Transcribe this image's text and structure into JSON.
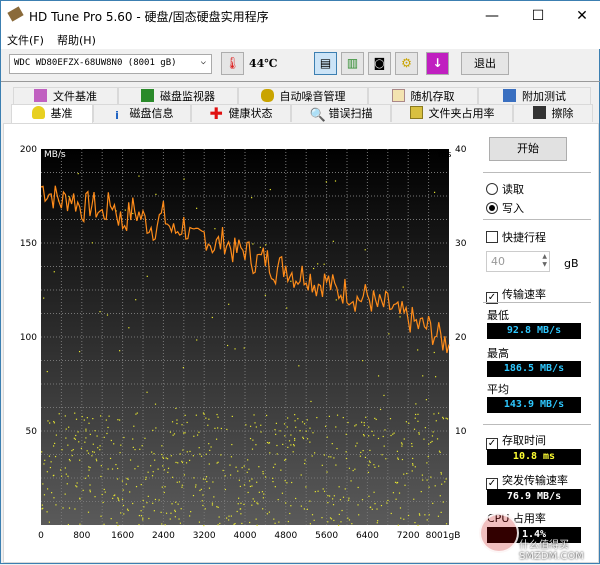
{
  "window": {
    "title": "HD Tune Pro 5.60 - 硬盘/固态硬盘实用程序",
    "minimize": "—",
    "maximize": "☐",
    "close": "✕"
  },
  "menu": [
    "文件(F)",
    "帮助(H)"
  ],
  "toolbar": {
    "drive": "WDC WD80EFZX-68UW8N0 (8001 gB)",
    "temperature": "44℃",
    "exit": "退出"
  },
  "tabs_top": [
    {
      "label": "文件基准",
      "icon": "file-benchmark-icon"
    },
    {
      "label": "磁盘监视器",
      "icon": "disk-monitor-icon"
    },
    {
      "label": "自动噪音管理",
      "icon": "speaker-icon"
    },
    {
      "label": "随机存取",
      "icon": "random-access-icon"
    },
    {
      "label": "附加测试",
      "icon": "extra-tests-icon"
    }
  ],
  "tabs_bottom": [
    {
      "label": "基准",
      "icon": "bulb-icon"
    },
    {
      "label": "磁盘信息",
      "icon": "info-icon"
    },
    {
      "label": "健康状态",
      "icon": "health-cross-icon"
    },
    {
      "label": "错误扫描",
      "icon": "magnifier-icon"
    },
    {
      "label": "文件夹占用率",
      "icon": "folder-icon"
    },
    {
      "label": "擦除",
      "icon": "trash-icon"
    }
  ],
  "side": {
    "start": "开始",
    "read": "读取",
    "write": "写入",
    "short_stroke": "快捷行程",
    "stroke_value": "40",
    "stroke_unit": "gB",
    "transfer_rate": "传输速率",
    "min_label": "最低",
    "min": "92.8 MB/s",
    "max_label": "最高",
    "max": "186.5 MB/s",
    "avg_label": "平均",
    "avg": "143.9 MB/s",
    "access_time": "存取时间",
    "access": "10.8 ms",
    "burst_rate": "突发传输速率",
    "burst": "76.9 MB/s",
    "cpu_label": "CPU 占用率",
    "cpu": "1.4%"
  },
  "watermark": "什么值得买 SMZDM.COM",
  "colors": {
    "line": "#ff8c1a",
    "dots": "#e8e830",
    "accent_value": "#2ec8ff",
    "access_value": "#ffff33"
  },
  "chart_data": {
    "type": "line",
    "ylabel": "MB/s",
    "y2label": "ms",
    "xunit": "gB",
    "ylim": [
      0,
      200
    ],
    "y2lim": [
      0,
      40
    ],
    "xlim": [
      0,
      8001
    ],
    "yticks": [
      "200",
      "150",
      "100",
      "50"
    ],
    "y2ticks": [
      "40",
      "30",
      "20",
      "10"
    ],
    "xticks": [
      "0",
      "800",
      "1600",
      "2400",
      "3200",
      "4000",
      "4800",
      "5600",
      "6400",
      "7200",
      "8001gB"
    ],
    "series": [
      {
        "name": "transfer rate (MB/s)",
        "x_step": 200,
        "values": [
          180,
          176,
          172,
          175,
          168,
          171,
          165,
          172,
          160,
          168,
          163,
          158,
          165,
          155,
          160,
          150,
          155,
          148,
          152,
          145,
          147,
          140,
          142,
          136,
          138,
          132,
          134,
          128,
          130,
          124,
          125,
          120,
          122,
          116,
          117,
          112,
          110,
          106,
          105,
          100,
          96
        ]
      }
    ],
    "access_time_scatter": {
      "name": "access time (ms)",
      "typical_range": [
        0,
        12
      ]
    }
  }
}
